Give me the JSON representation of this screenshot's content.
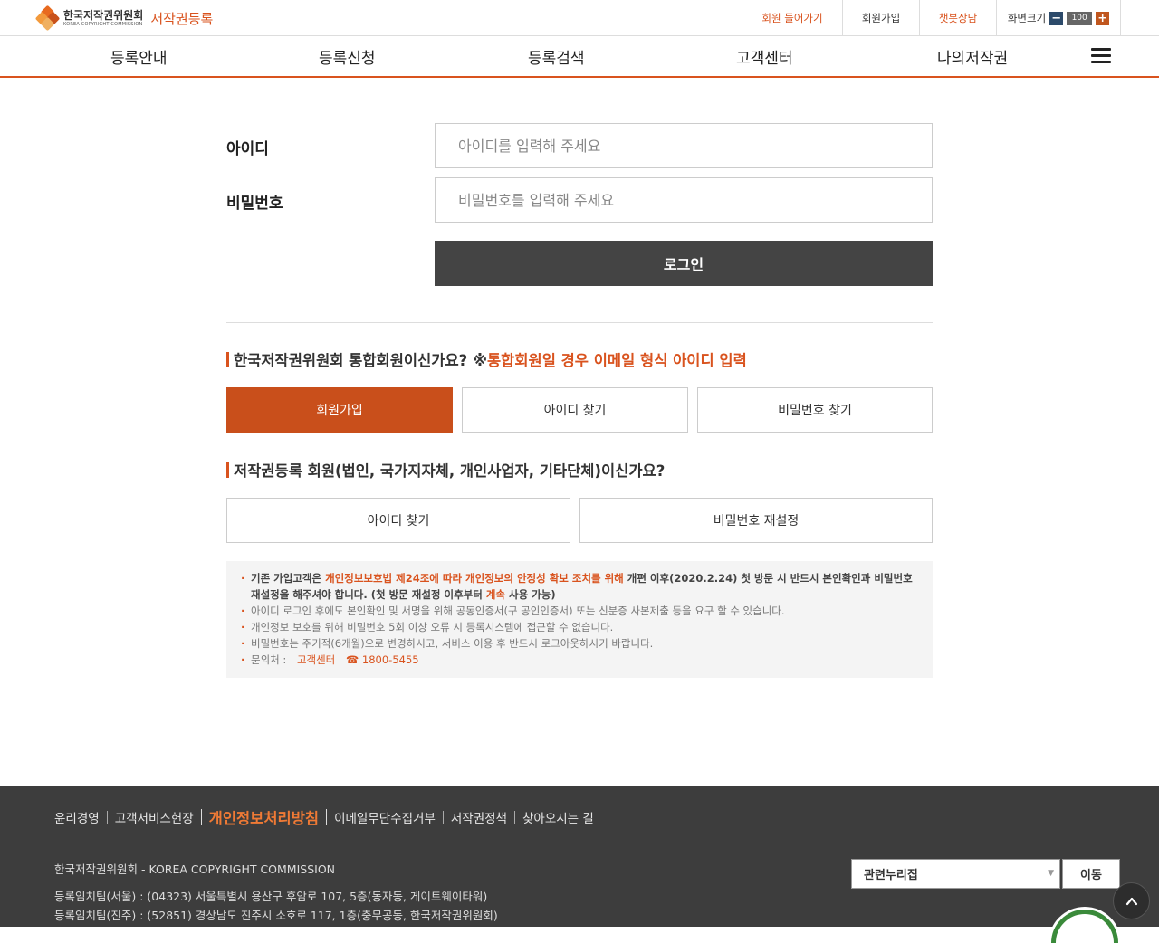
{
  "header": {
    "logo_ko": "한국저작권위원회",
    "logo_en": "KOREA COPYRIGHT COMMISSION",
    "service_name": "저작권등록",
    "util": {
      "login": "회원 들어가기",
      "join": "회원가입",
      "chatbot": "챗봇상담",
      "zoom_label": "화면크기",
      "zoom_value": "100"
    }
  },
  "gnb": {
    "items": [
      {
        "label": "등록안내"
      },
      {
        "label": "등록신청"
      },
      {
        "label": "등록검색"
      },
      {
        "label": "고객센터"
      },
      {
        "label": "나의저작권"
      }
    ]
  },
  "login_form": {
    "id_label": "아이디",
    "id_placeholder": "아이디를 입력해 주세요",
    "pw_label": "비밀번호",
    "pw_placeholder": "비밀번호를 입력해 주세요",
    "submit": "로그인"
  },
  "integrated": {
    "title": "한국저작권위원회 통합회원이신가요? ※",
    "highlight": "통합회원일 경우 이메일 형식 아이디 입력",
    "buttons": [
      "회원가입",
      "아이디 찾기",
      "비밀번호 찾기"
    ]
  },
  "registration_member": {
    "title": "저작권등록 회원(법인, 국가지자체, 개인사업자, 기타단체)이신가요?",
    "buttons": [
      "아이디 찾기",
      "비밀번호 재설정"
    ]
  },
  "notice": {
    "n1_a": "기존 가입고객은 ",
    "n1_b": "개인정보보호법 제24조에 따라 개인정보의 안정성 확보 조치를 위해",
    "n1_c": " 개편 이후(2020.2.24) 첫 방문 시 반드시 본인확인과 비밀번호 재설정을 해주셔야 합니다. (첫 방문 재설정 이후부터 ",
    "n1_d": "계속",
    "n1_e": " 사용 가능)",
    "n2": "아이디 로그인 후에도 본인확인 및 서명을 위해 공동인증서(구 공인인증서) 또는 신분증 사본제출 등을 요구 할 수 있습니다.",
    "n3": "개인정보 보호를 위해 비밀번호 5회 이상 오류 시 등록시스템에 접근할 수 없습니다.",
    "n4": "비밀번호는 주기적(6개월)으로 변경하시고, 서비스 이용 후 반드시 로그아웃하시기 바랍니다.",
    "inquiry_label": "문의처 :",
    "inquiry_center": "고객센터",
    "inquiry_phone": "☎ 1800-5455"
  },
  "footer": {
    "links": [
      "윤리경영",
      "고객서비스헌장",
      "개인정보처리방침",
      "이메일무단수집거부",
      "저작권정책",
      "찾아오시는 길"
    ],
    "org": "한국저작권위원회 - KOREA COPYRIGHT COMMISSION",
    "addr1": "등록임치팀(서울) : (04323) 서울특별시 용산구 후암로 107, 5층(동자동, 게이트웨이타워)",
    "addr2": "등록임치팀(진주) : (52851) 경상남도 진주시 소호로 117, 1층(충무공동, 한국저작권위원회)",
    "related_select": "관련누리집",
    "go_button": "이동"
  },
  "colors": {
    "accent": "#d9531e",
    "primary_button": "#c94f1b",
    "login_button": "#444444",
    "footer_bg": "#3d3d3d"
  },
  "icons": {
    "menu": "hamburger-icon",
    "zoom_out": "minus-icon",
    "zoom_in": "plus-icon",
    "scroll_top": "chevron-up-icon"
  }
}
